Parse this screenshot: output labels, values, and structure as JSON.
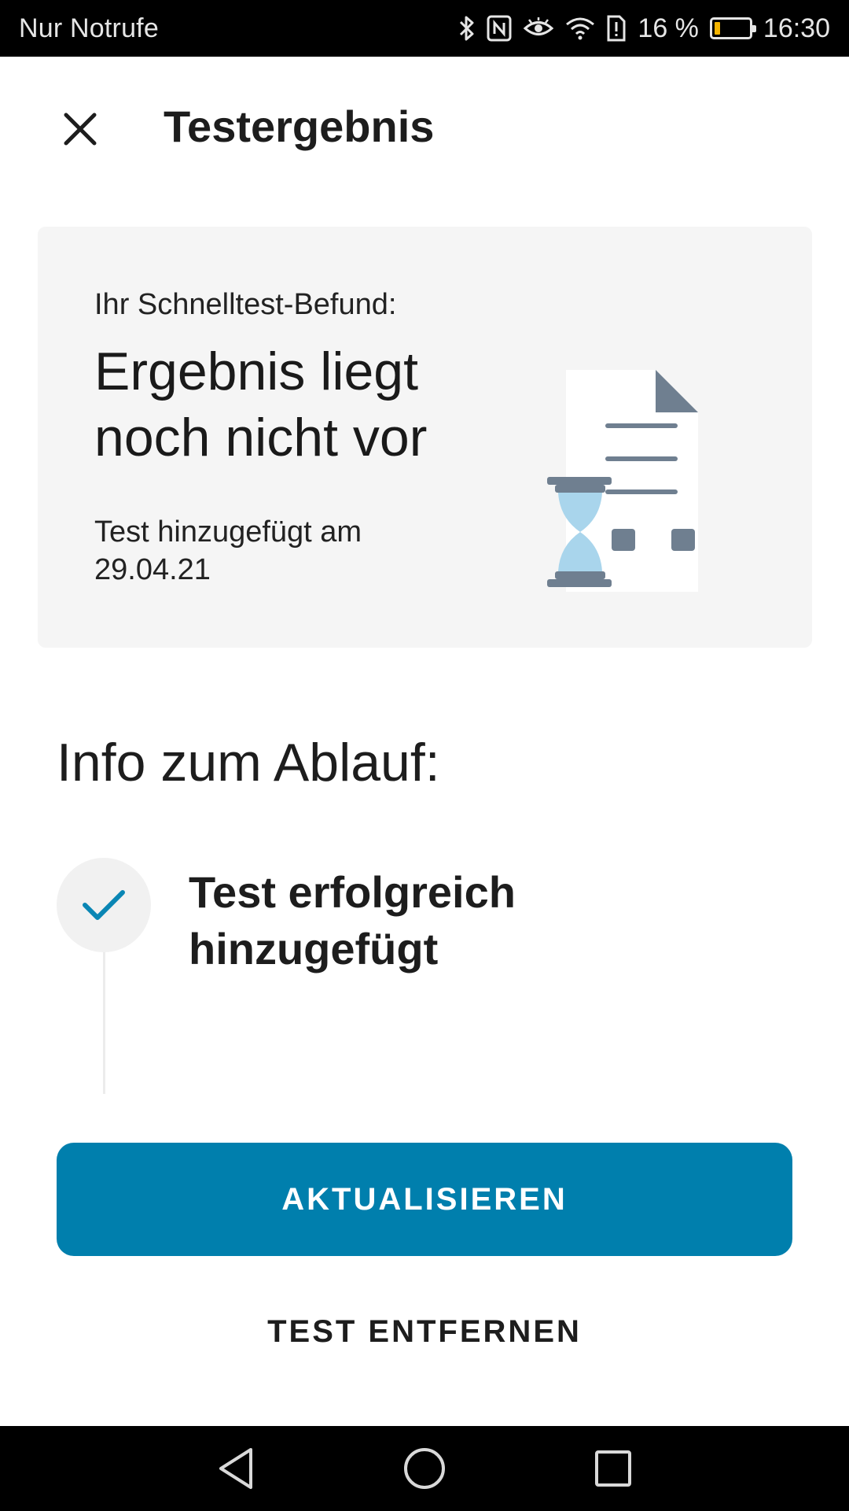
{
  "status_bar": {
    "carrier": "Nur Notrufe",
    "battery_text": "16 %",
    "battery_level": 0.16,
    "time": "16:30",
    "icons": [
      "bluetooth-icon",
      "nfc-icon",
      "eye-comfort-icon",
      "wifi-icon",
      "sim-alert-icon",
      "battery-icon"
    ],
    "battery_color": "#f5b400"
  },
  "toolbar": {
    "close_icon": "close-icon",
    "title": "Testergebnis"
  },
  "result_card": {
    "label": "Ihr Schnelltest-Befund:",
    "result": "Ergebnis liegt noch nicht vor",
    "date_text": "Test hinzugefügt am 29.04.21",
    "illustration": "document-hourglass-illustration"
  },
  "info": {
    "heading": "Info zum Ablauf:",
    "steps": [
      {
        "icon": "checkmark-icon",
        "text": "Test erfolgreich hinzugefügt",
        "done": true
      }
    ]
  },
  "actions": {
    "refresh_label": "AKTUALISIEREN",
    "remove_label": "TEST ENTFERNEN",
    "accent_color": "#007fad"
  },
  "nav_bar": {
    "icons": [
      "back-icon",
      "home-icon",
      "recents-icon"
    ]
  }
}
